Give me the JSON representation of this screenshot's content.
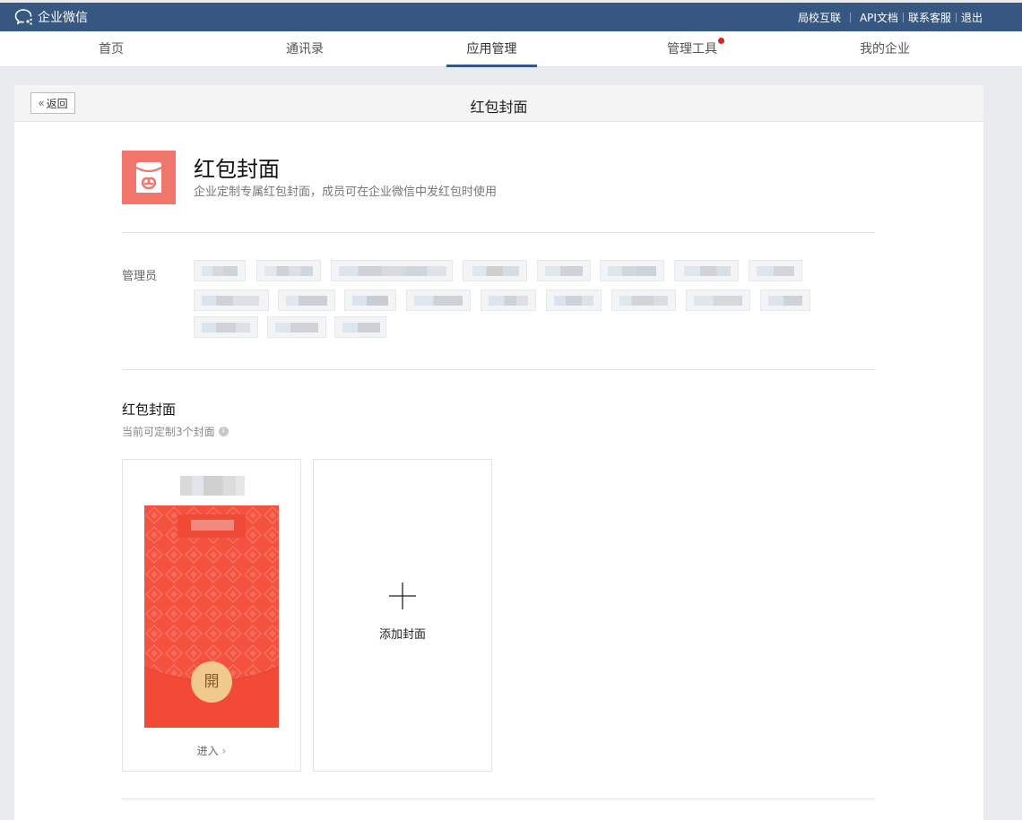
{
  "topbar": {
    "brand": "企业微信",
    "links": [
      "局校互联",
      "API文档",
      "联系客服",
      "退出"
    ]
  },
  "nav": {
    "tabs": [
      {
        "label": "首页",
        "active": false,
        "badge": false
      },
      {
        "label": "通讯录",
        "active": false,
        "badge": false
      },
      {
        "label": "应用管理",
        "active": true,
        "badge": true
      },
      {
        "label": "管理工具",
        "active": false,
        "badge": true
      },
      {
        "label": "我的企业",
        "active": false,
        "badge": false
      }
    ]
  },
  "panel": {
    "back_label": "返回",
    "title": "红包封面"
  },
  "app": {
    "name": "红包封面",
    "description": "企业定制专属红包封面，成员可在企业微信中发红包时使用",
    "icon": "red-packet-icon",
    "icon_color": "#f0756a"
  },
  "admins": {
    "label": "管理员"
  },
  "covers": {
    "title": "红包封面",
    "subtitle": "当前可定制3个封面",
    "enter_label": "进入",
    "open_char": "開",
    "add_label": "添加封面"
  },
  "colors": {
    "topbar": "#355781",
    "accent_tab": "#355781",
    "badge": "#e0201a",
    "packet_red": "#f4523f",
    "open_button": "#f0c98e"
  }
}
